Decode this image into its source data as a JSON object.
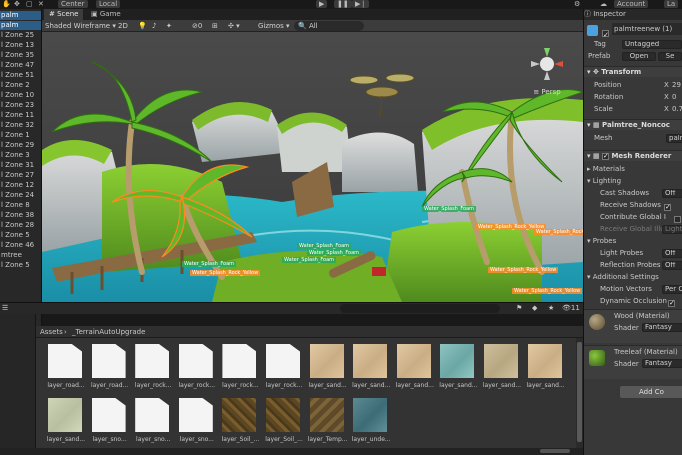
{
  "toolbar": {
    "pivot_label": "Center",
    "space_label": "Local",
    "account_label": "Account",
    "layers_label": "La",
    "play_icon": "play-icon",
    "pause_icon": "pause-icon",
    "step_icon": "step-icon"
  },
  "hierarchy": {
    "items": [
      {
        "label": "palm",
        "selected": true
      },
      {
        "label": "palm",
        "selected": true
      },
      {
        "label": "l Zone 25",
        "selected": false
      },
      {
        "label": "l Zone 13",
        "selected": false
      },
      {
        "label": "l Zone 35",
        "selected": false
      },
      {
        "label": "l Zone 47",
        "selected": false
      },
      {
        "label": "l Zone 51",
        "selected": false
      },
      {
        "label": "l Zone 2",
        "selected": false
      },
      {
        "label": "l Zone 10",
        "selected": false
      },
      {
        "label": "l Zone 23",
        "selected": false
      },
      {
        "label": "l Zone 11",
        "selected": false
      },
      {
        "label": "l Zone 32",
        "selected": false
      },
      {
        "label": "l Zone 1",
        "selected": false
      },
      {
        "label": "l Zone 29",
        "selected": false
      },
      {
        "label": "l Zone 3",
        "selected": false
      },
      {
        "label": "l Zone 31",
        "selected": false
      },
      {
        "label": "l Zone 27",
        "selected": false
      },
      {
        "label": "l Zone 12",
        "selected": false
      },
      {
        "label": "l Zone 24",
        "selected": false
      },
      {
        "label": "l Zone 8",
        "selected": false
      },
      {
        "label": "l Zone 38",
        "selected": false
      },
      {
        "label": "l Zone 28",
        "selected": false
      },
      {
        "label": "l Zone 5",
        "selected": false
      },
      {
        "label": "l Zone 46",
        "selected": false
      },
      {
        "label": "mtree",
        "selected": false
      },
      {
        "label": "l Zone 5",
        "selected": false
      }
    ]
  },
  "scene": {
    "tab_scene": "Scene",
    "tab_game": "Game",
    "shading_mode": "Shaded Wireframe",
    "toggle_2d": "2D",
    "gizmos_label": "Gizmos",
    "search_placeholder": "All",
    "fx_count": "0",
    "labels": [
      "Water_Splash_Rock_Yellow",
      "Water_Splash_Foam",
      "Water_Splash_Foam",
      "Water_Splash_Foam",
      "Water_Splash_Rock_Yellow",
      "Water_Splash_Rock_Yellow",
      "Water_Splash_Rock_Yellow",
      "Water_Splash_Foam",
      "Water_Splash_Foam",
      "Water_Splash_Rock_Yellow"
    ]
  },
  "project": {
    "breadcrumb_root": "Assets",
    "breadcrumb_folder": "_TerrainAutoUpgrade",
    "hidden_count": "11",
    "assets": [
      {
        "name": "layer_road...",
        "kind": "doc"
      },
      {
        "name": "layer_road...",
        "kind": "doc"
      },
      {
        "name": "layer_rock...",
        "kind": "doc"
      },
      {
        "name": "layer_rock...",
        "kind": "doc"
      },
      {
        "name": "layer_rock...",
        "kind": "doc"
      },
      {
        "name": "layer_rock...",
        "kind": "doc"
      },
      {
        "name": "layer_sand...",
        "kind": "sand"
      },
      {
        "name": "layer_sand...",
        "kind": "sand"
      },
      {
        "name": "layer_sand...",
        "kind": "sand"
      },
      {
        "name": "layer_sand...",
        "kind": "water"
      },
      {
        "name": "layer_sand...",
        "kind": "dune"
      },
      {
        "name": "layer_sand...",
        "kind": "sand"
      },
      {
        "name": "layer_sand...",
        "kind": "pale"
      },
      {
        "name": "layer_sno...",
        "kind": "doc"
      },
      {
        "name": "layer_sno...",
        "kind": "doc"
      },
      {
        "name": "layer_sno...",
        "kind": "doc"
      },
      {
        "name": "layer_Soil_...",
        "kind": "soil"
      },
      {
        "name": "layer_Soil_...",
        "kind": "soil"
      },
      {
        "name": "layer_Temp...",
        "kind": "temp"
      },
      {
        "name": "layer_unde...",
        "kind": "under"
      }
    ]
  },
  "inspector": {
    "tab": "Inspector",
    "object_name": "palmtreenew (1)",
    "tag_label": "Tag",
    "tag_value": "Untagged",
    "prefab_label": "Prefab",
    "prefab_open": "Open",
    "prefab_select": "Se",
    "transform_header": "Transform",
    "position_label": "Position",
    "position_x": "29",
    "rotation_label": "Rotation",
    "rotation_x": "0",
    "scale_label": "Scale",
    "scale_x": "0.7",
    "axis_x": "X",
    "meshfilter_header": "Palmtree_Noncoc",
    "mesh_label": "Mesh",
    "mesh_value": "palm",
    "renderer_header": "Mesh Renderer",
    "materials_label": "Materials",
    "lighting_label": "Lighting",
    "cast_shadows_label": "Cast Shadows",
    "cast_shadows_value": "Off",
    "receive_shadows_label": "Receive Shadows",
    "contribute_gi_label": "Contribute Global I",
    "receive_gi_label": "Receive Global Illu",
    "receive_gi_value": "Light",
    "probes_label": "Probes",
    "light_probes_label": "Light Probes",
    "light_probes_value": "Off",
    "reflection_probes_label": "Reflection Probes",
    "reflection_probes_value": "Off",
    "additional_label": "Additional Settings",
    "motion_vectors_label": "Motion Vectors",
    "motion_vectors_value": "Per C",
    "dynamic_occlusion_label": "Dynamic Occlusion",
    "mat1_name": "Wood (Material)",
    "mat1_shader_label": "Shader",
    "mat1_shader_value": "Fantasy Fo",
    "mat2_name": "Treeleaf (Material)",
    "mat2_shader_label": "Shader",
    "mat2_shader_value": "Fantasy Fo",
    "add_component": "Add Co"
  }
}
